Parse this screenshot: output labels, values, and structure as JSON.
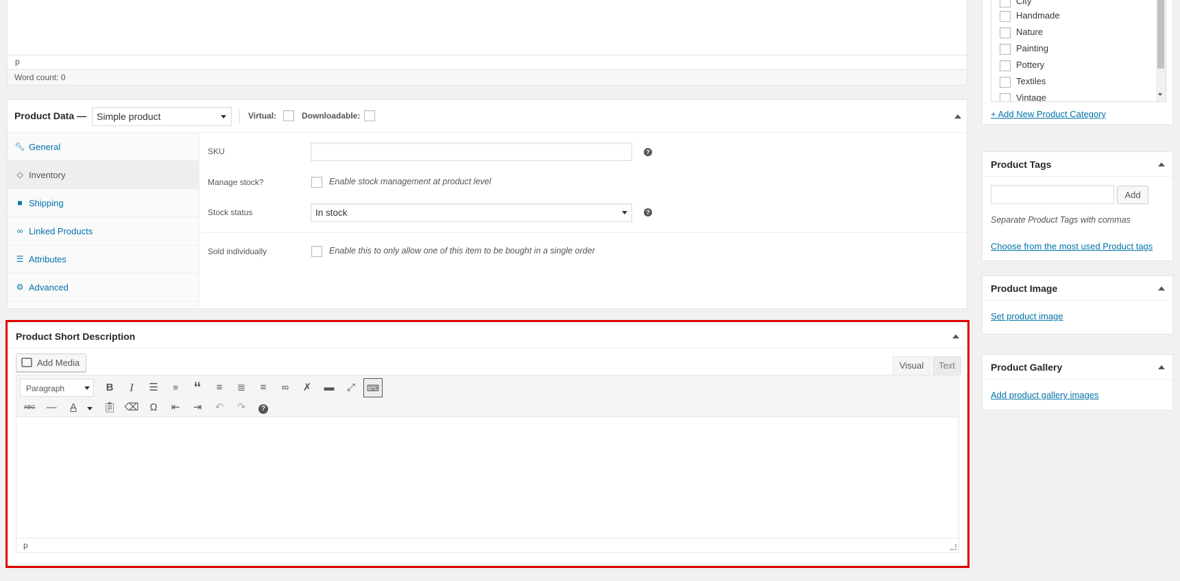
{
  "main_editor": {
    "path": "p",
    "word_count": "Word count: 0"
  },
  "product_data": {
    "title": "Product Data —",
    "type_select": "Simple product",
    "virtual_label": "Virtual:",
    "downloadable_label": "Downloadable:",
    "tabs": [
      {
        "label": "General",
        "icon": "wrench-icon"
      },
      {
        "label": "Inventory",
        "icon": "tag-icon"
      },
      {
        "label": "Shipping",
        "icon": "truck-icon"
      },
      {
        "label": "Linked Products",
        "icon": "link-icon"
      },
      {
        "label": "Attributes",
        "icon": "list-icon"
      },
      {
        "label": "Advanced",
        "icon": "gear-icon"
      }
    ],
    "active_tab": "Inventory",
    "inventory": {
      "sku_label": "SKU",
      "sku_value": "",
      "manage_stock_label": "Manage stock?",
      "manage_stock_desc": "Enable stock management at product level",
      "stock_status_label": "Stock status",
      "stock_status_value": "In stock",
      "sold_individually_label": "Sold individually",
      "sold_individually_desc": "Enable this to only allow one of this item to be bought in a single order"
    }
  },
  "short_description": {
    "title": "Product Short Description",
    "add_media": "Add Media",
    "tab_visual": "Visual",
    "tab_text": "Text",
    "format_select": "Paragraph",
    "path": "p",
    "highlight_color": "#e00000"
  },
  "sidebar": {
    "categories": {
      "items": [
        "City",
        "Handmade",
        "Nature",
        "Painting",
        "Pottery",
        "Textiles",
        "Vintage"
      ],
      "add_link": "+ Add New Product Category"
    },
    "tags": {
      "title": "Product Tags",
      "add_button": "Add",
      "hint": "Separate Product Tags with commas",
      "choose_link": "Choose from the most used Product tags"
    },
    "image": {
      "title": "Product Image",
      "link": "Set product image"
    },
    "gallery": {
      "title": "Product Gallery",
      "link": "Add product gallery images"
    }
  }
}
